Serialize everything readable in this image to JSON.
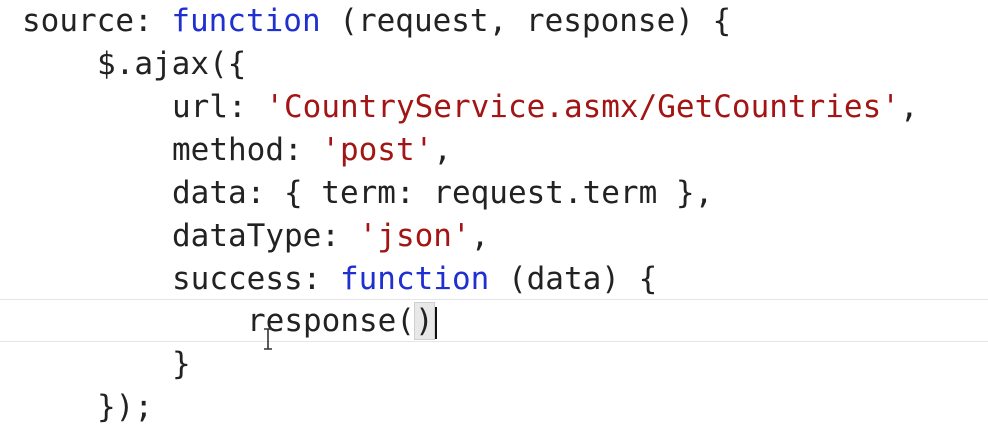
{
  "colors": {
    "keyword": "#1f2fd0",
    "string": "#a31515",
    "text": "#222222",
    "background": "#ffffff"
  },
  "code": {
    "l1": {
      "a": "source: ",
      "kw": "function",
      "b": " (request, response) {"
    },
    "l2": {
      "a": "$.ajax({"
    },
    "l3": {
      "a": "url: ",
      "str": "'CountryService.asmx/GetCountries'",
      "b": ","
    },
    "l4": {
      "a": "method: ",
      "str": "'post'",
      "b": ","
    },
    "l5": {
      "a": "data: { term: request.term },"
    },
    "l6": {
      "a": "dataType: ",
      "str": "'json'",
      "b": ","
    },
    "l7": {
      "a": "success: ",
      "kw": "function",
      "b": " (data) {"
    },
    "l8": {
      "a": "response(",
      "b": ")"
    },
    "l9": {
      "a": "}"
    },
    "l10": {
      "a": "});"
    }
  },
  "icons": {
    "cursor": "ibeam-cursor-icon",
    "caret": "text-caret-icon"
  }
}
